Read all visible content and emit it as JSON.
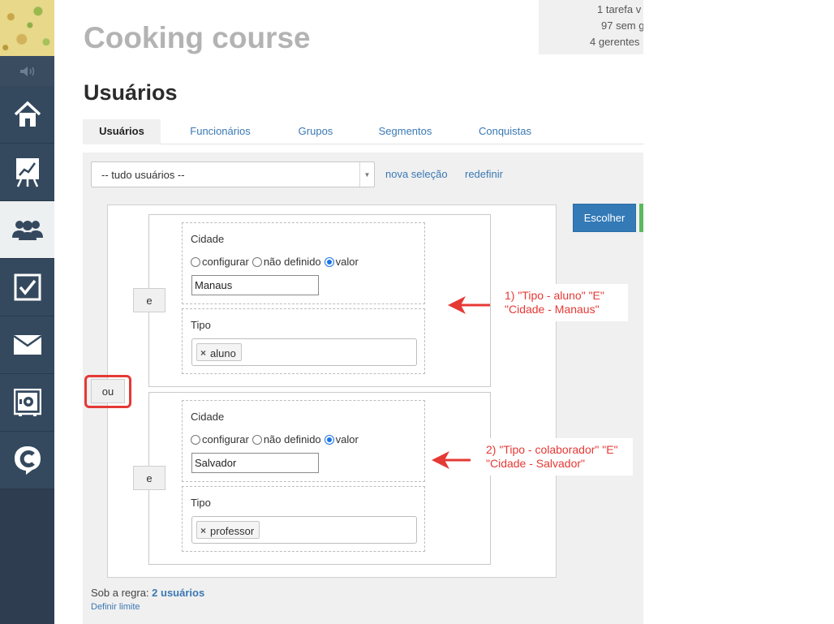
{
  "course": {
    "title": "Cooking course",
    "stats": [
      "1 tarefa v",
      "97 sem g",
      "4 gerentes"
    ]
  },
  "sidebar": {
    "items": [
      {
        "name": "home",
        "active": false
      },
      {
        "name": "reports",
        "active": false
      },
      {
        "name": "users",
        "active": true
      },
      {
        "name": "tasks",
        "active": false
      },
      {
        "name": "mail",
        "active": false
      },
      {
        "name": "settings",
        "active": false
      },
      {
        "name": "chat",
        "active": false
      }
    ]
  },
  "page": {
    "title": "Usuários"
  },
  "tabs": [
    {
      "label": "Usuários",
      "active": true
    },
    {
      "label": "Funcionários",
      "active": false
    },
    {
      "label": "Grupos",
      "active": false
    },
    {
      "label": "Segmentos",
      "active": false
    },
    {
      "label": "Conquistas",
      "active": false
    }
  ],
  "filter": {
    "selected": "-- tudo usuários --",
    "new_selection": "nova seleção",
    "reset": "redefinir",
    "choose_button": "Escolher"
  },
  "rules": {
    "outer_operator": "ou",
    "groups": [
      {
        "operator": "e",
        "city": {
          "label": "Cidade",
          "options": [
            "configurar",
            "não definido",
            "valor"
          ],
          "selected": "valor",
          "value": "Manaus"
        },
        "type": {
          "label": "Tipo",
          "tags": [
            "aluno"
          ]
        },
        "note": "1) \"Tipo - aluno\" \"E\" \"Cidade - Manaus\""
      },
      {
        "operator": "e",
        "city": {
          "label": "Cidade",
          "options": [
            "configurar",
            "não definido",
            "valor"
          ],
          "selected": "valor",
          "value": "Salvador"
        },
        "type": {
          "label": "Tipo",
          "tags": [
            "professor"
          ]
        },
        "note": "2) \"Tipo - colaborador\" \"E\" \"Cidade - Salvador\""
      }
    ]
  },
  "notes": {
    "n1_line1": "1) \"Tipo - aluno\" \"E\"",
    "n1_line2": "\"Cidade - Manaus\"",
    "n2_line1": "2) \"Tipo - colaborador\" \"E\"",
    "n2_line2": "\"Cidade - Salvador\""
  },
  "footer": {
    "rule_prefix": "Sob a regra:",
    "rule_count": "2 usuários",
    "limit": "Definir limite"
  },
  "colors": {
    "accent": "#337ab7",
    "sidebar": "#34495e",
    "annotation": "#e53935"
  }
}
